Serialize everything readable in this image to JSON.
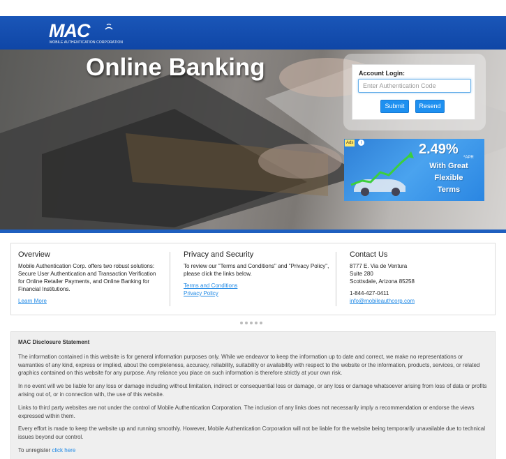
{
  "header": {
    "logo_text": "MAC",
    "logo_subtitle": "MOBILE AUTHENTICATION CORPORATION"
  },
  "hero": {
    "title": "Online Banking"
  },
  "login": {
    "label": "Account Login:",
    "placeholder": "Enter Authentication Code",
    "value": "",
    "submit_label": "Submit",
    "resend_label": "Resend"
  },
  "ad": {
    "badge": "Ads",
    "info_icon": "i",
    "rate": "2.49%",
    "apr": "*APR",
    "line1": "With Great",
    "line2": "Flexible",
    "line3": "Terms"
  },
  "overview": {
    "title": "Overview",
    "text": "Mobile Authentication Corp. offers two robust solutions: Secure User Authentication and Transaction Verification for Online Retailer Payments, and Online Banking for Financial Institutions.",
    "link": "Learn More"
  },
  "privacy": {
    "title": "Privacy and Security",
    "text": "To review our \"Terms and Conditions\" and \"Privacy Policy\", please click the links below.",
    "link_terms": "Terms and Conditions",
    "link_privacy": "Privacy Policy"
  },
  "contact": {
    "title": "Contact Us",
    "address1": "8777 E. Via de Ventura",
    "address2": "Suite 280",
    "address3": "Scottsdale, Arizona 85258",
    "phone": "1-844-427-0411",
    "email": "info@mobileauthcorp.com"
  },
  "disclosure": {
    "title": "MAC Disclosure Statement",
    "p1": "The information contained in this website is for general information purposes only. While we endeavor to keep the information up to date and correct, we make no representations or warranties of any kind, express or implied, about the completeness, accuracy, reliability, suitability or availability with respect to the website or the information, products, services, or related graphics contained on this website for any purpose. Any reliance you place on such information is therefore strictly at your own risk.",
    "p2": "In no event will we be liable for any loss or damage including without limitation, indirect or consequential loss or damage, or any loss or damage whatsoever arising from loss of data or profits arising out of, or in connection with, the use of this website.",
    "p3": "Links to third party websites are not under the control of Mobile Authentication Corporation. The inclusion of any links does not necessarily imply a recommendation or endorse the views expressed within them.",
    "p4": "Every effort is made to keep the website up and running smoothly. However, Mobile Authentication Corporation will not be liable for the website being temporarily unavailable due to technical issues beyond our control.",
    "unregister_text": "To unregister",
    "unregister_link": "click here"
  },
  "colors": {
    "header_blue": "#0f46a6",
    "button_blue": "#1e90f0",
    "link_blue": "#1e88e5"
  }
}
